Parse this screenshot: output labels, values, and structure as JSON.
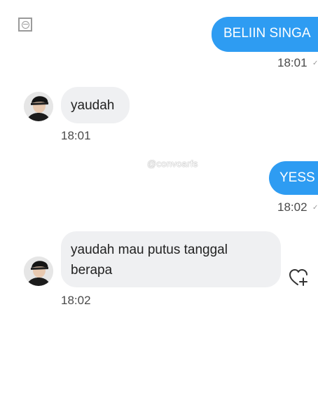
{
  "colors": {
    "outgoing_bubble": "#2e9cf2",
    "incoming_bubble": "#eff0f2",
    "timestamp": "#4a4a4a"
  },
  "top_left_icon": "status-icon",
  "watermark": "@convoarfs",
  "messages": [
    {
      "direction": "outgoing",
      "text": "BELIIN SINGA",
      "time": "18:01"
    },
    {
      "direction": "incoming",
      "text": "yaudah",
      "time": "18:01"
    },
    {
      "direction": "outgoing",
      "text": "YESS",
      "time": "18:02"
    },
    {
      "direction": "incoming",
      "text": "yaudah mau putus tanggal berapa",
      "time": "18:02"
    }
  ],
  "reaction_icon": "heart-plus-icon"
}
